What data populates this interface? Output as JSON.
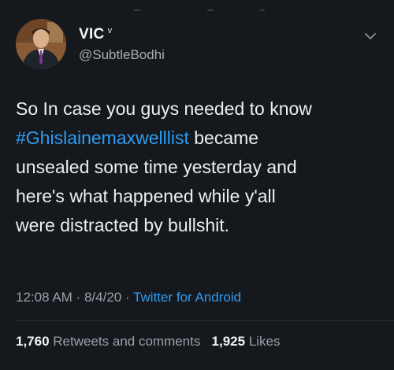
{
  "tweet": {
    "display_name": "VIC",
    "name_badge": "v",
    "handle": "@SubtleBodhi",
    "text_lines": [
      "So In case you guys needed to know",
      "became",
      "unsealed some time yesterday and",
      "here's what happened while y'all",
      "were distracted by bullshit."
    ],
    "hashtag": "#Ghislainemaxwelllist",
    "time": "12:08 AM",
    "date": "8/4/20",
    "separator": "·",
    "source": "Twitter for Android",
    "retweets_count": "1,760",
    "retweets_label": "Retweets and comments",
    "likes_count": "1,925",
    "likes_label": "Likes"
  },
  "icons": {
    "avatar": "profile-photo",
    "menu": "chevron-down-icon"
  },
  "colors": {
    "background": "#15181d",
    "text": "#eceef0",
    "secondary": "#9aa1a8",
    "link": "#2f9cf0"
  }
}
